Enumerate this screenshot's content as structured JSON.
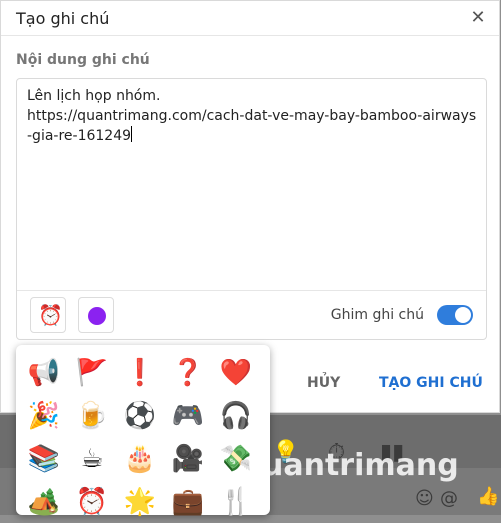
{
  "dialog": {
    "title": "Tạo ghi chú",
    "close_icon": "close-icon",
    "section_label": "Nội dung ghi chú",
    "note_text": "Lên lịch họp nhóm.\nhttps://quantrimang.com/cach-dat-ve-may-bay-bamboo-airways-gia-re-161249",
    "toolbar": {
      "alarm_icon": "⏰",
      "color_hex": "#8b22f0",
      "pin_label": "Ghim ghi chú",
      "pin_on": true
    },
    "cancel_label": "HỦY",
    "create_label": "TẠO GHI CHÚ"
  },
  "emoji_picker": {
    "emojis": [
      "📢",
      "🚩",
      "❗",
      "❓",
      "❤️",
      "🎉",
      "🍺",
      "⚽",
      "🎮",
      "🎧",
      "📚",
      "☕",
      "🎂",
      "🎥",
      "💸",
      "🏕️",
      "⏰",
      "🌟",
      "💼",
      "🍴"
    ]
  },
  "background": {
    "watermark": "uantrimang"
  }
}
